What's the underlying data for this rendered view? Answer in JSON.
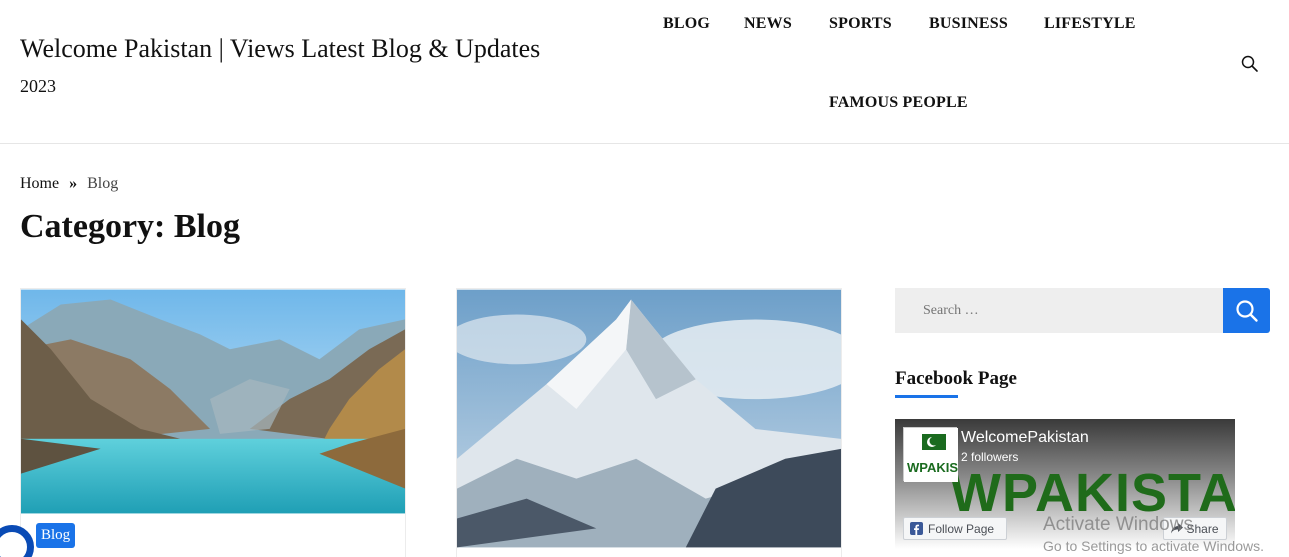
{
  "header": {
    "site_title": "Welcome Pakistan | Views Latest Blog & Updates",
    "site_title_year": "2023",
    "nav": [
      "BLOG",
      "NEWS",
      "SPORTS",
      "BUSINESS",
      "LIFESTYLE",
      "FAMOUS PEOPLE"
    ],
    "search_icon": "search-icon"
  },
  "breadcrumb": {
    "home": "Home",
    "separator": "»",
    "current": "Blog"
  },
  "page_title": "Category: Blog",
  "posts": [
    {
      "category": "Blog",
      "image": "lake-valley-photo"
    },
    {
      "image": "snow-mountain-photo"
    }
  ],
  "sidebar": {
    "search_placeholder": "Search …",
    "facebook_widget_title": "Facebook Page",
    "facebook": {
      "page_name": "WelcomePakistan",
      "followers": "2 followers",
      "banner_text": "WPAKISTAN",
      "logo_text": "WPAKISTAN",
      "follow_label": "Follow Page",
      "share_label": "Share"
    }
  },
  "watermark": {
    "line1": "Activate Windows",
    "line2": "Go to Settings to activate Windows."
  },
  "colors": {
    "accent": "#1a73e8",
    "text": "#111111"
  }
}
